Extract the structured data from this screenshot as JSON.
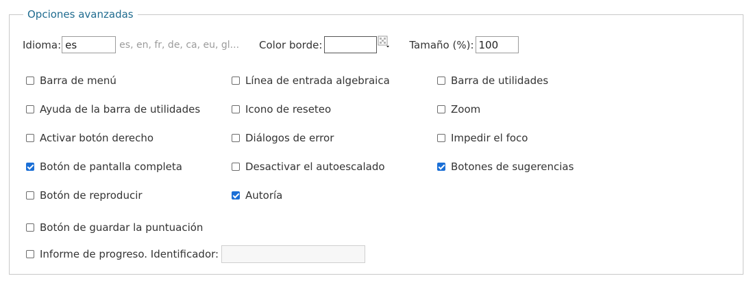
{
  "section": {
    "legend": "Opciones avanzadas"
  },
  "top_row": {
    "language_label": "Idioma:",
    "language_value": "es",
    "language_hint": "es, en, fr, de, ca, eu, gl...",
    "border_color_label": "Color borde:",
    "border_color_value": "#ffffff",
    "size_label": "Tamaño (%):",
    "size_value": "100"
  },
  "options": [
    {
      "label": "Barra de menú",
      "checked": false
    },
    {
      "label": "Línea de entrada algebraica",
      "checked": false
    },
    {
      "label": "Barra de utilidades",
      "checked": false
    },
    {
      "label": "Ayuda de la barra de utilidades",
      "checked": false
    },
    {
      "label": "Icono de reseteo",
      "checked": false
    },
    {
      "label": "Zoom",
      "checked": false
    },
    {
      "label": "Activar botón derecho",
      "checked": false
    },
    {
      "label": "Diálogos de error",
      "checked": false
    },
    {
      "label": "Impedir el foco",
      "checked": false
    },
    {
      "label": "Botón de pantalla completa",
      "checked": true
    },
    {
      "label": "Desactivar el autoescalado",
      "checked": false
    },
    {
      "label": "Botones de sugerencias",
      "checked": true
    },
    {
      "label": "Botón de reproducir",
      "checked": false
    },
    {
      "label": "Autoría",
      "checked": true
    },
    {
      "label": "Botón de guardar la puntuación",
      "checked": false
    },
    {
      "label": "Informe de progreso. Identificador:",
      "checked": false
    }
  ],
  "progress_identifier": {
    "value": ""
  },
  "colors": {
    "accent": "#1f6b8f",
    "checkbox_checked": "#1b6fd6"
  }
}
